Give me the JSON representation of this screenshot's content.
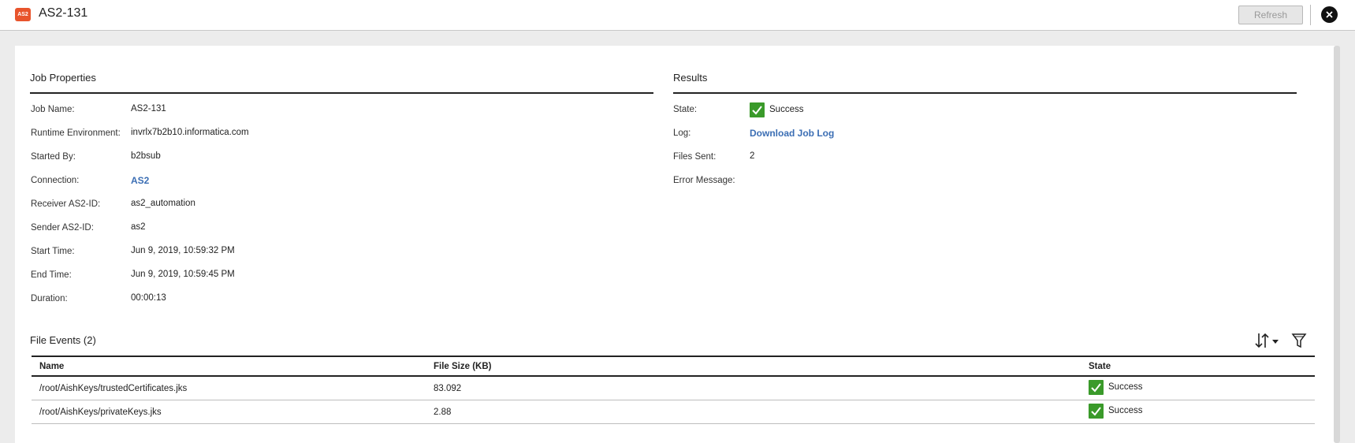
{
  "header": {
    "app_icon_label": "AS2",
    "title": "AS2-131",
    "refresh_label": "Refresh",
    "close_icon": "close-icon"
  },
  "job_properties": {
    "title": "Job Properties",
    "fields": [
      {
        "label": "Job Name:",
        "value": "AS2-131"
      },
      {
        "label": "Runtime Environment:",
        "value": "invrlx7b2b10.informatica.com"
      },
      {
        "label": "Started By:",
        "value": "b2bsub"
      },
      {
        "label": "Connection:",
        "value": "AS2"
      },
      {
        "label": "Receiver AS2-ID:",
        "value": "as2_automation"
      },
      {
        "label": "Sender AS2-ID:",
        "value": "as2"
      },
      {
        "label": "Start Time:",
        "value": "Jun 9, 2019, 10:59:32 PM"
      },
      {
        "label": "End Time:",
        "value": "Jun 9, 2019, 10:59:45 PM"
      },
      {
        "label": "Duration:",
        "value": "00:00:13"
      }
    ]
  },
  "results": {
    "title": "Results",
    "state_label": "State:",
    "state_value": "Success",
    "log_label": "Log:",
    "log_link": "Download Job Log",
    "files_sent_label": "Files Sent:",
    "files_sent_value": "2",
    "error_label": "Error Message:",
    "error_value": ""
  },
  "file_events": {
    "title": "File Events (2)",
    "columns": [
      "Name",
      "File Size (KB)",
      "State"
    ],
    "rows": [
      {
        "name": "/root/AishKeys/trustedCertificates.jks",
        "size": "83.092",
        "state": "Success"
      },
      {
        "name": "/root/AishKeys/privateKeys.jks",
        "size": "2.88",
        "state": "Success"
      }
    ]
  },
  "colors": {
    "success_green": "#3a9a2a",
    "link_blue": "#3b6eb4",
    "app_icon_orange": "#e8542c"
  }
}
